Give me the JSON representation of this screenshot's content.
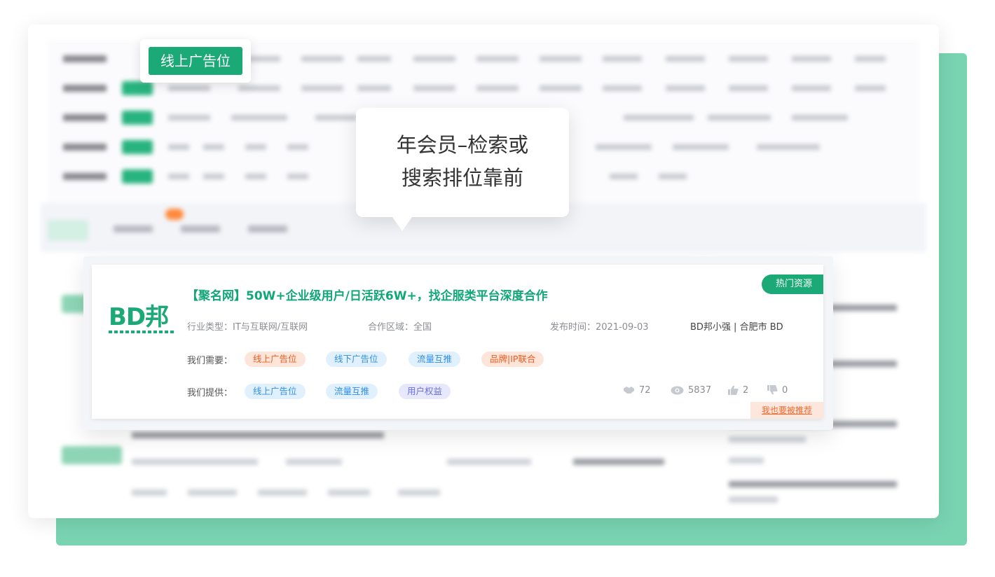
{
  "callout": {
    "label": "线上广告位"
  },
  "tooltip": {
    "line1": "年会员–检索或",
    "line2": "搜索排位靠前"
  },
  "card": {
    "logo_text": "BD邦",
    "title": "【聚名网】50W+企业级用户/日活跃6W+，找企服类平台深度合作",
    "badge": "热门资源",
    "industry_label": "行业类型：",
    "industry_value": "IT与互联网/互联网",
    "region_label": "合作区域：",
    "region_value": "全国",
    "publish_label": "发布时间：",
    "publish_value": "2021-09-03",
    "owner": "BD邦小强 | 合肥市 BD",
    "needs_label": "我们需要：",
    "needs": [
      "线上广告位",
      "线下广告位",
      "流量互推",
      "品牌|IP联合"
    ],
    "offers_label": "我们提供：",
    "offers": [
      "线上广告位",
      "流量互推",
      "用户权益"
    ],
    "stats": {
      "contacts": "72",
      "views": "5837",
      "likes": "2",
      "dislikes": "0"
    },
    "recommend_link": "我也要被推荐"
  },
  "colors": {
    "brand_green": "#1aa977",
    "backdrop_green": "#79d4b2",
    "tag_orange": "#f05a1e",
    "tag_blue": "#2f8fe8",
    "tag_purple": "#6a6fe8"
  }
}
